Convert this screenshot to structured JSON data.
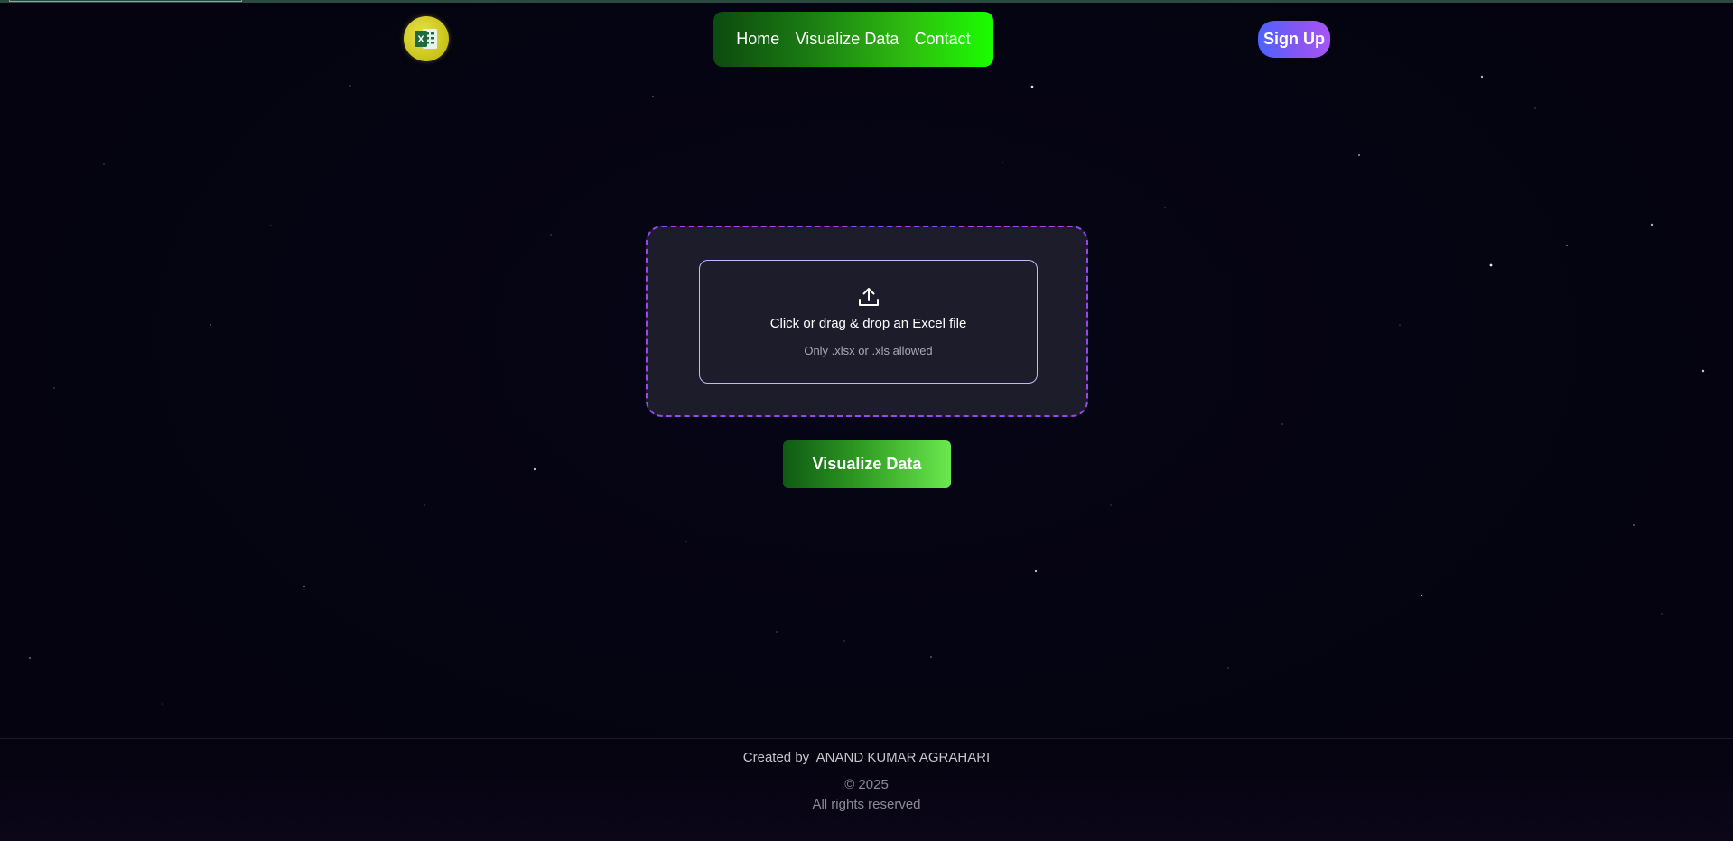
{
  "header": {
    "logo_icon": "excel-icon",
    "logo_letter": "X",
    "nav": [
      {
        "label": "Home"
      },
      {
        "label": "Visualize Data"
      },
      {
        "label": "Contact"
      }
    ],
    "signup_label": "Sign Up"
  },
  "upload": {
    "icon": "upload-icon",
    "title": "Click or drag & drop an Excel file",
    "hint": "Only .xlsx or .xls allowed"
  },
  "action": {
    "visualize_label": "Visualize Data"
  },
  "footer": {
    "created_by": "Created by  ANAND KUMAR AGRAHARI",
    "copyright": "© 2025",
    "rights": "All rights reserved"
  },
  "colors": {
    "background": "#04030f",
    "nav_gradient_start": "#0d4a10",
    "nav_gradient_end": "#1aff00",
    "signup_gradient_start": "#4c63ff",
    "signup_gradient_end": "#a855f7",
    "upload_border": "#9a45f0",
    "upload_card_bg": "#1d1c2a",
    "visualize_gradient_end": "#6be84e",
    "logo_bg": "#c9c21a"
  }
}
